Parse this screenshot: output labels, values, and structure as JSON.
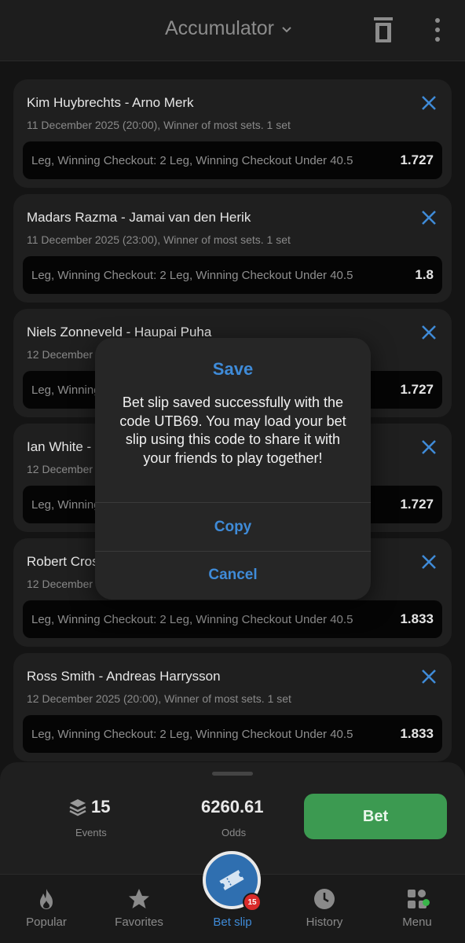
{
  "header": {
    "title": "Accumulator"
  },
  "cards": [
    {
      "title": "Kim Huybrechts - Arno Merk",
      "subtitle": "11 December 2025 (20:00), Winner of most sets. 1 set",
      "market": "Leg, Winning Checkout: 2 Leg, Winning Checkout Under 40.5",
      "odds": "1.727"
    },
    {
      "title": "Madars Razma - Jamai van den Herik",
      "subtitle": "11 December 2025 (23:00), Winner of most sets. 1 set",
      "market": "Leg, Winning Checkout: 2 Leg, Winning Checkout Under 40.5",
      "odds": "1.8"
    },
    {
      "title": "Niels Zonneveld - Haupai Puha",
      "subtitle": "12 December",
      "market": "Leg, Winning",
      "odds": "1.727"
    },
    {
      "title": "Ian White -",
      "subtitle": "12 December",
      "market": "Leg, Winning",
      "odds": "1.727"
    },
    {
      "title": "Robert Cros",
      "subtitle": "12 December",
      "market": "Leg, Winning Checkout: 2 Leg, Winning Checkout Under 40.5",
      "odds": "1.833"
    },
    {
      "title": "Ross Smith - Andreas Harrysson",
      "subtitle": "12 December 2025 (20:00), Winner of most sets. 1 set",
      "market": "Leg, Winning Checkout: 2 Leg, Winning Checkout Under 40.5",
      "odds": "1.833"
    }
  ],
  "dialog": {
    "title": "Save",
    "message": "Bet slip saved successfully with the code UTB69. You may load your bet slip using this code to share it with your friends to play together!",
    "copy": "Copy",
    "cancel": "Cancel"
  },
  "summary": {
    "events_value": "15",
    "events_label": "Events",
    "odds_value": "6260.61",
    "odds_label": "Odds",
    "bet_label": "Bet"
  },
  "nav": {
    "popular": "Popular",
    "favorites": "Favorites",
    "betslip": "Bet slip",
    "betslip_badge": "15",
    "history": "History",
    "menu": "Menu"
  },
  "colors": {
    "accent": "#3f8bd8",
    "bet": "#3c9a51",
    "badge": "#d92b2b"
  }
}
